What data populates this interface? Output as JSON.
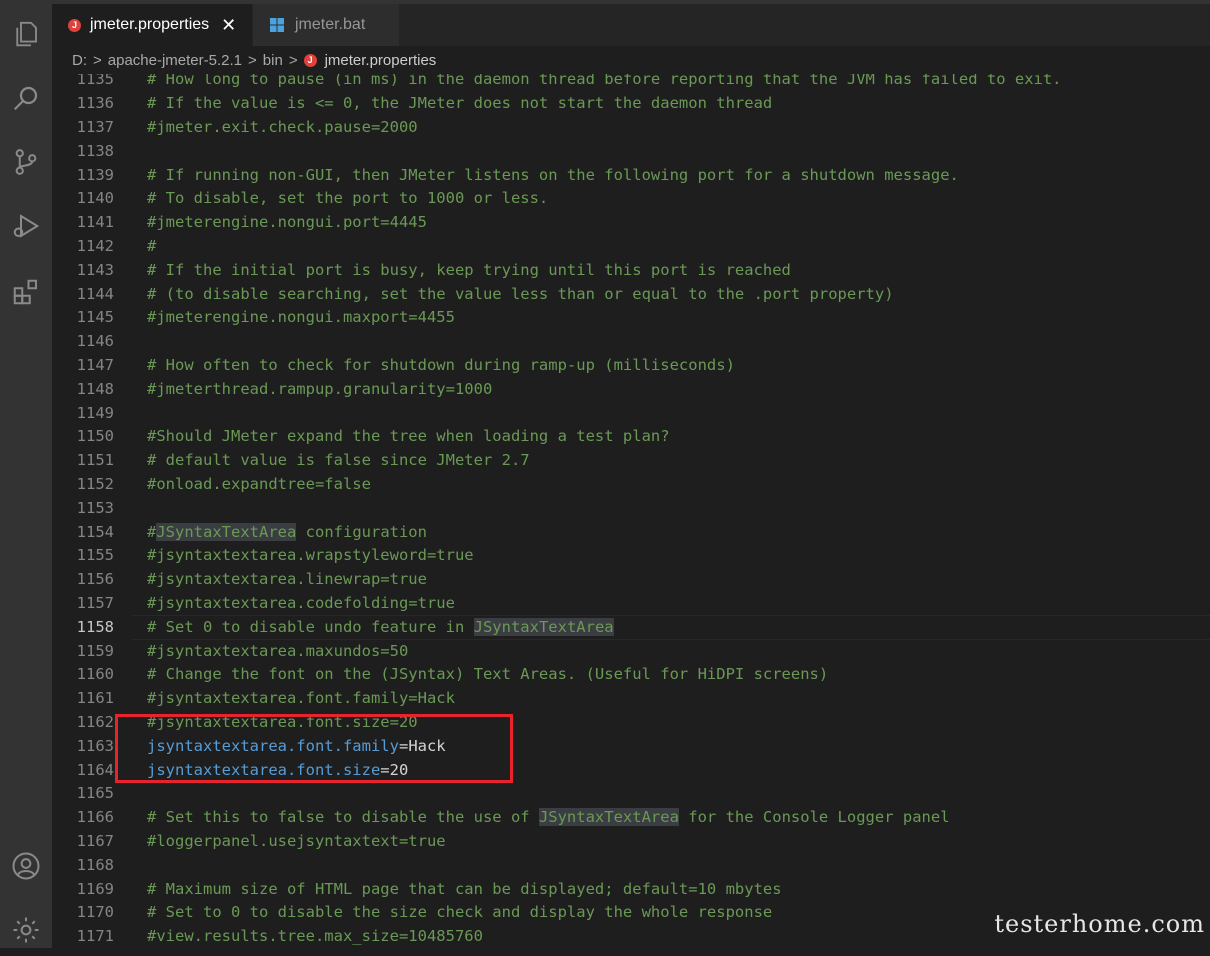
{
  "tabs": [
    {
      "label": "jmeter.properties",
      "close": "✕"
    },
    {
      "label": "jmeter.bat"
    }
  ],
  "breadcrumb": {
    "drive": "D:",
    "folder": "apache-jmeter-5.2.1",
    "subfolder": "bin",
    "file": "jmeter.properties",
    "sep": ">"
  },
  "file_icon_letter": "J",
  "activity_icons": [
    "files-icon",
    "search-icon",
    "source-control-icon",
    "debug-icon",
    "extensions-icon",
    "account-icon",
    "settings-icon"
  ],
  "lines": [
    {
      "n": "1135",
      "c": "# How long to pause (in ms) in the daemon thread before reporting that the JVM has failed to exit."
    },
    {
      "n": "1136",
      "c": "# If the value is <= 0, the JMeter does not start the daemon thread"
    },
    {
      "n": "1137",
      "c": "#jmeter.exit.check.pause=2000"
    },
    {
      "n": "1138",
      "c": ""
    },
    {
      "n": "1139",
      "c": "# If running non-GUI, then JMeter listens on the following port for a shutdown message."
    },
    {
      "n": "1140",
      "c": "# To disable, set the port to 1000 or less."
    },
    {
      "n": "1141",
      "c": "#jmeterengine.nongui.port=4445"
    },
    {
      "n": "1142",
      "c": "#"
    },
    {
      "n": "1143",
      "c": "# If the initial port is busy, keep trying until this port is reached"
    },
    {
      "n": "1144",
      "c": "# (to disable searching, set the value less than or equal to the .port property)"
    },
    {
      "n": "1145",
      "c": "#jmeterengine.nongui.maxport=4455"
    },
    {
      "n": "1146",
      "c": ""
    },
    {
      "n": "1147",
      "c": "# How often to check for shutdown during ramp-up (milliseconds)"
    },
    {
      "n": "1148",
      "c": "#jmeterthread.rampup.granularity=1000"
    },
    {
      "n": "1149",
      "c": ""
    },
    {
      "n": "1150",
      "c": "#Should JMeter expand the tree when loading a test plan?"
    },
    {
      "n": "1151",
      "c": "# default value is false since JMeter 2.7"
    },
    {
      "n": "1152",
      "c": "#onload.expandtree=false"
    },
    {
      "n": "1153",
      "c": ""
    },
    {
      "n": "1154",
      "c": "#JSyntaxTextArea configuration"
    },
    {
      "n": "1155",
      "c": "#jsyntaxtextarea.wrapstyleword=true"
    },
    {
      "n": "1156",
      "c": "#jsyntaxtextarea.linewrap=true"
    },
    {
      "n": "1157",
      "c": "#jsyntaxtextarea.codefolding=true"
    },
    {
      "n": "1158",
      "c": "# Set 0 to disable undo feature in JSyntaxTextArea"
    },
    {
      "n": "1159",
      "c": "#jsyntaxtextarea.maxundos=50"
    },
    {
      "n": "1160",
      "c": "# Change the font on the (JSyntax) Text Areas. (Useful for HiDPI screens)"
    },
    {
      "n": "1161",
      "c": "#jsyntaxtextarea.font.family=Hack"
    },
    {
      "n": "1162",
      "c": "#jsyntaxtextarea.font.size=20"
    },
    {
      "n": "1163",
      "k": "jsyntaxtextarea.font.family",
      "v": "Hack"
    },
    {
      "n": "1164",
      "k": "jsyntaxtextarea.font.size",
      "v": "20"
    },
    {
      "n": "1165",
      "c": ""
    },
    {
      "n": "1166",
      "c": "# Set this to false to disable the use of JSyntaxTextArea for the Console Logger panel"
    },
    {
      "n": "1167",
      "c": "#loggerpanel.usejsyntaxtext=true"
    },
    {
      "n": "1168",
      "c": ""
    },
    {
      "n": "1169",
      "c": "# Maximum size of HTML page that can be displayed; default=10 mbytes"
    },
    {
      "n": "1170",
      "c": "# Set to 0 to disable the size check and display the whole response"
    },
    {
      "n": "1171",
      "c": "#view.results.tree.max_size=10485760"
    },
    {
      "n": "1172",
      "c": ""
    }
  ],
  "current_line": "1158",
  "watermark": "testerhome.com"
}
